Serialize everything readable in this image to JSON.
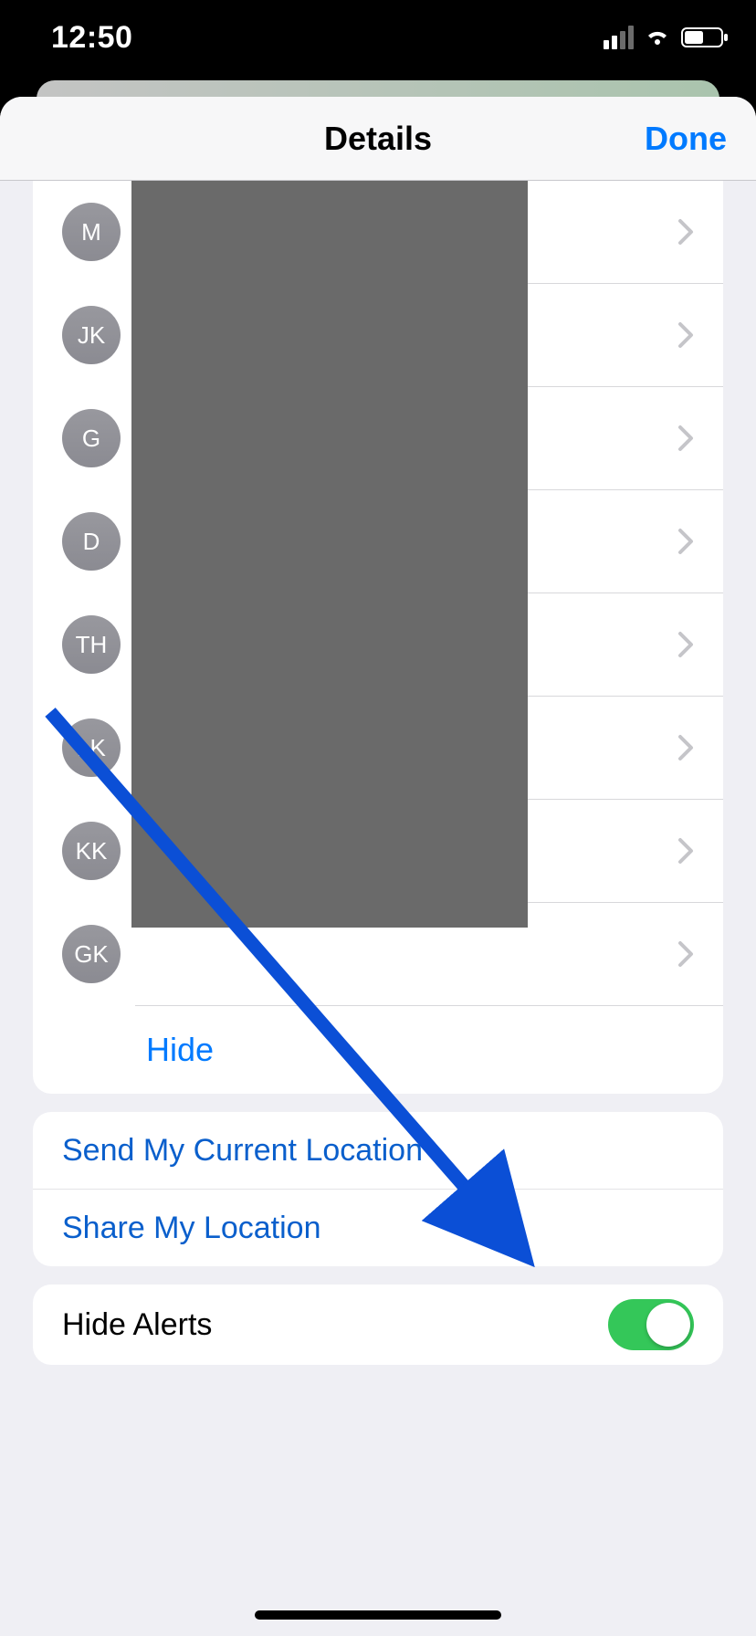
{
  "status": {
    "time": "12:50"
  },
  "nav": {
    "title": "Details",
    "done": "Done"
  },
  "contacts": [
    {
      "initials": "M"
    },
    {
      "initials": "JK"
    },
    {
      "initials": "G"
    },
    {
      "initials": "D"
    },
    {
      "initials": "TH"
    },
    {
      "initials": "LK"
    },
    {
      "initials": "KK"
    },
    {
      "initials": "GK"
    }
  ],
  "hide_label": "Hide",
  "actions": {
    "send_location": "Send My Current Location",
    "share_location": "Share My Location"
  },
  "hide_alerts": {
    "label": "Hide Alerts",
    "on": true
  },
  "colors": {
    "link": "#007aff",
    "accent_green": "#34c759"
  }
}
